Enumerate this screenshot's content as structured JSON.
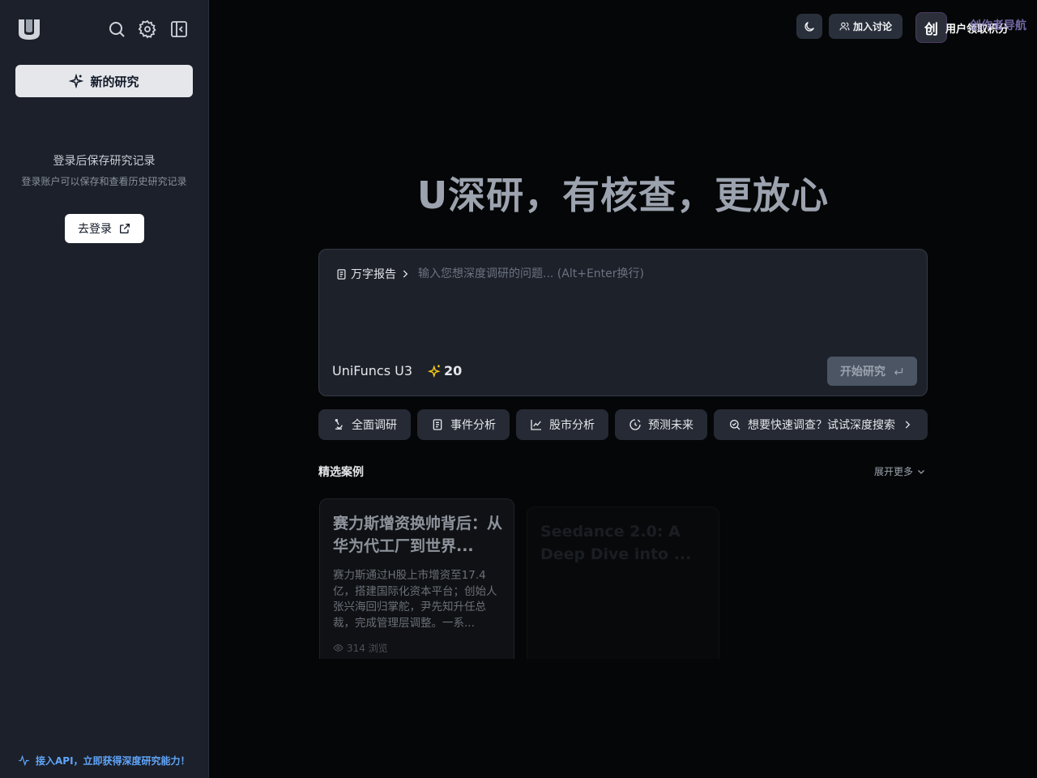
{
  "sidebar": {
    "new_research_label": "新的研究",
    "save_title": "登录后保存研究记录",
    "save_subtitle": "登录账户可以保存和查看历史研究记录",
    "login_label": "去登录",
    "api_link": "接入API，立即获得深度研究能力！"
  },
  "topbar": {
    "join_label": "加入讨论",
    "promo_icon_text": "创",
    "promo_text": "用户领取积分",
    "promo_tag": "创作者导航"
  },
  "hero": {
    "title": "U深研，有核查，更放心"
  },
  "composer": {
    "mode_label": "万字报告",
    "placeholder": "输入您想深度调研的问题... (Alt+Enter换行)",
    "model_name": "UniFuncs U3",
    "credits": "20",
    "start_label": "开始研究"
  },
  "chips": [
    {
      "label": "全面调研",
      "icon": "research-icon"
    },
    {
      "label": "事件分析",
      "icon": "document-icon"
    },
    {
      "label": "股市分析",
      "icon": "chart-line-icon"
    },
    {
      "label": "预测未来",
      "icon": "predict-icon"
    },
    {
      "label": "想要快速调查？试试深度搜索",
      "icon": "search-icon"
    }
  ],
  "featured": {
    "title": "精选案例",
    "expand_label": "展开更多",
    "cases": [
      {
        "title": "赛力斯增资换帅背后：从华为代工厂到世界...",
        "description": "赛力斯通过H股上市增资至17.4亿，搭建国际化资本平台；创始人张兴海回归掌舵，尹先知升任总裁，完成管理层调整。一系...",
        "views": "314 浏览"
      },
      {
        "title": "Seedance 2.0: A Deep Dive into ...",
        "description": "",
        "views": ""
      }
    ]
  },
  "colors": {
    "background": "#050607",
    "sidebar": "#1b202a",
    "accent_link": "#60a5fa",
    "credit_star": "#facc15"
  }
}
